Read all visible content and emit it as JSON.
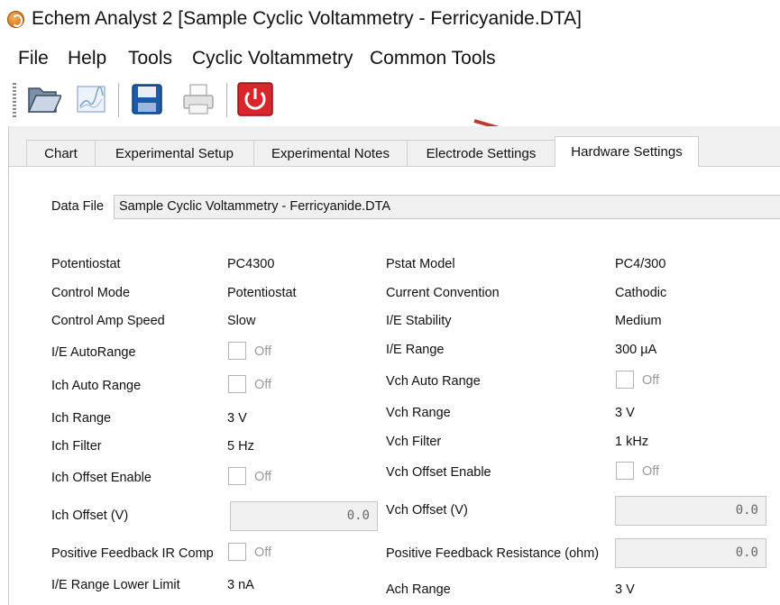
{
  "window": {
    "title": "Echem Analyst 2 [Sample Cyclic Voltammetry - Ferricyanide.DTA]"
  },
  "menu": [
    "File",
    "Help",
    "Tools",
    "Cyclic Voltammetry",
    "Common Tools"
  ],
  "toolbar": [
    "open-folder-icon",
    "chart-icon",
    "save-icon",
    "print-icon",
    "power-icon"
  ],
  "tabs": [
    "Chart",
    "Experimental Setup",
    "Experimental Notes",
    "Electrode Settings",
    "Hardware Settings"
  ],
  "active_tab": "Hardware Settings",
  "data_file": {
    "label": "Data File",
    "value": "Sample Cyclic Voltammetry - Ferricyanide.DTA"
  },
  "off_text": "Off",
  "left": [
    {
      "label": "Potentiostat",
      "value": "PC4300"
    },
    {
      "label": "Control Mode",
      "value": "Potentiostat"
    },
    {
      "label": "Control Amp Speed",
      "value": "Slow"
    },
    {
      "label": "I/E AutoRange",
      "checkbox": false
    },
    {
      "label": "Ich Auto Range",
      "checkbox": false
    },
    {
      "label": "Ich Range",
      "value": "3 V"
    },
    {
      "label": "Ich Filter",
      "value": "5 Hz"
    },
    {
      "label": "Ich Offset Enable",
      "checkbox": false
    },
    {
      "label": "Ich Offset (V)",
      "number": "0.0"
    },
    {
      "label": "Positive Feedback IR Comp",
      "checkbox": false
    },
    {
      "label": "I/E Range Lower Limit",
      "value": "3 nA"
    }
  ],
  "right": [
    {
      "label": "Pstat Model",
      "value": "PC4/300"
    },
    {
      "label": "Current Convention",
      "value": "Cathodic"
    },
    {
      "label": "I/E Stability",
      "value": "Medium"
    },
    {
      "label": "I/E Range",
      "value": "300 µA"
    },
    {
      "label": "Vch Auto Range",
      "checkbox": false
    },
    {
      "label": "Vch Range",
      "value": "3 V"
    },
    {
      "label": "Vch Filter",
      "value": "1 kHz"
    },
    {
      "label": "Vch Offset Enable",
      "checkbox": false
    },
    {
      "label": "Vch Offset (V)",
      "number": "0.0"
    },
    {
      "label": "Positive Feedback Resistance (ohm)",
      "number": "0.0"
    },
    {
      "label": "Ach Range",
      "value": "3 V"
    }
  ],
  "colors": {
    "arrow": "#c0392b",
    "power": "#d9262c",
    "save": "#1f5aa6"
  }
}
